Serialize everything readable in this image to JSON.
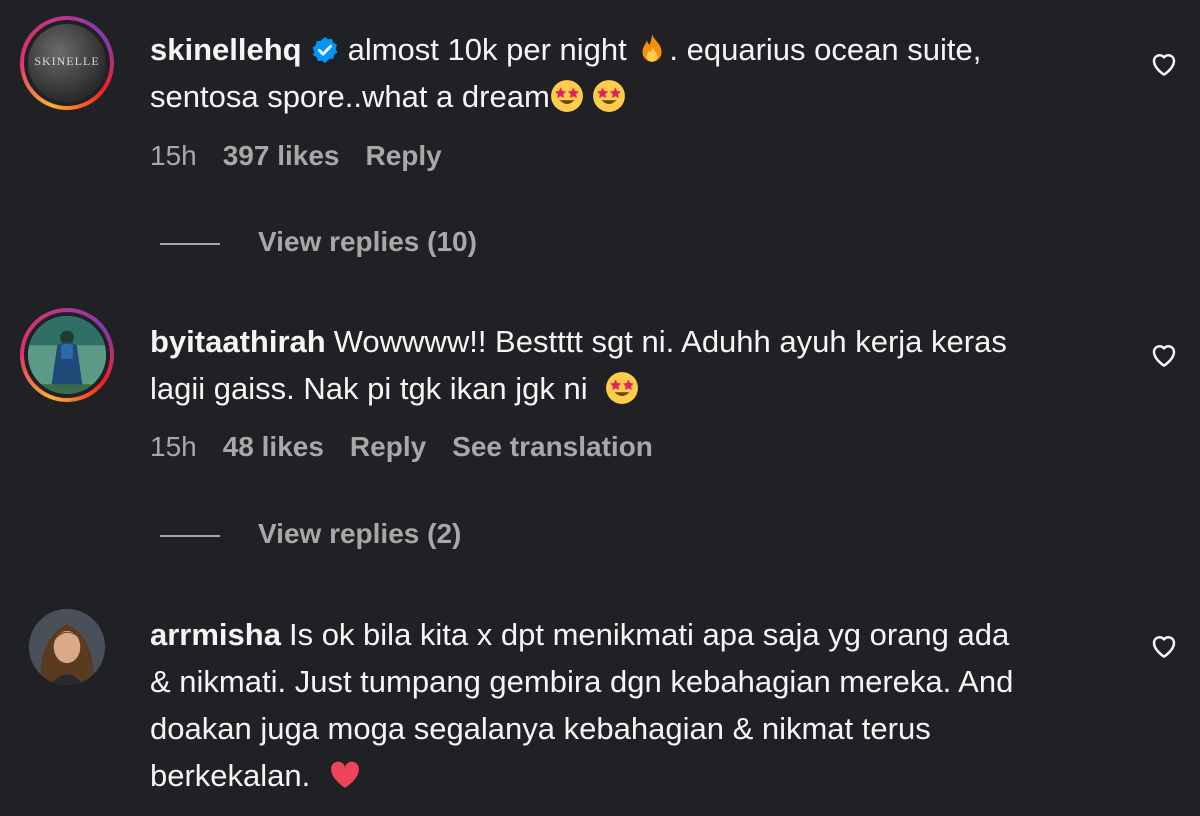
{
  "comments": [
    {
      "username": "skinellehq",
      "verified": true,
      "avatar_label": "SKINELLE",
      "text_part1": "almost 10k per night",
      "text_part2": ". equarius ocean suite,",
      "text_line2": "sentosa spore..what a dream",
      "time": "15h",
      "likes": "397 likes",
      "reply_label": "Reply",
      "view_replies": "View replies (10)"
    },
    {
      "username": "byitaathirah",
      "text_line1": "Wowwww!! Bestttt sgt ni. Aduhh ayuh kerja keras",
      "text_line2": "lagii gaiss. Nak pi tgk ikan jgk ni",
      "time": "15h",
      "likes": "48 likes",
      "reply_label": "Reply",
      "translate_label": "See translation",
      "view_replies": "View replies (2)"
    },
    {
      "username": "arrmisha",
      "text_line1": "Is ok bila kita x dpt menikmati apa saja yg orang ada",
      "text_line2": "& nikmati. Just tumpang gembira dgn kebahagian mereka. And",
      "text_line3": "doakan juga moga segalanya kebahagian & nikmat terus",
      "text_line4": "berkekalan."
    }
  ],
  "icons": {
    "like": "heart-outline-icon",
    "verified": "verified-badge-icon",
    "emoji_fire": "fire-emoji",
    "emoji_star_eyes": "star-struck-emoji",
    "emoji_heart": "red-heart-emoji"
  },
  "colors": {
    "background": "#202125",
    "text": "#f5f5f5",
    "secondary": "#a8a8a8",
    "verified": "#0095f6"
  }
}
